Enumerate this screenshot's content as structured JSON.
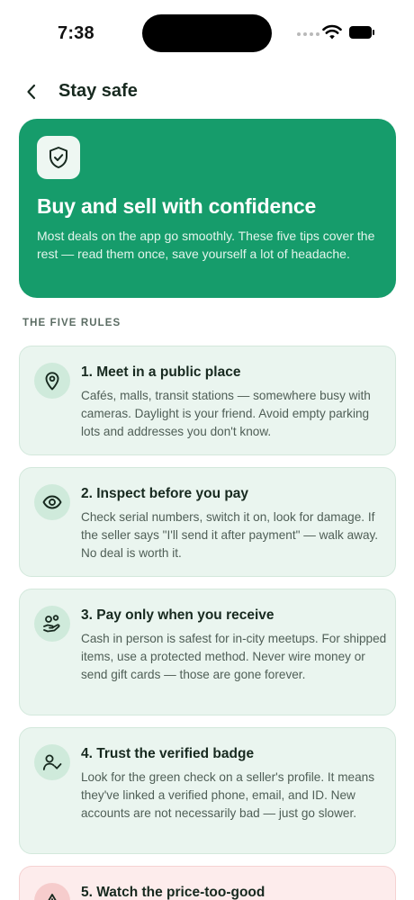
{
  "status": {
    "time": "7:38"
  },
  "nav": {
    "title": "Stay safe"
  },
  "hero": {
    "title": "Buy and sell with confidence",
    "body": "Most deals on the app go smoothly. These five tips cover the rest — read them once, save yourself a lot of headache."
  },
  "section_label": "THE FIVE RULES",
  "rules": [
    {
      "icon": "location-pin-icon",
      "title": "1. Meet in a public place",
      "body": "Cafés, malls, transit stations — somewhere busy with cameras. Daylight is your friend. Avoid empty parking lots and addresses you don't know."
    },
    {
      "icon": "eye-icon",
      "title": "2. Inspect before you pay",
      "body": "Check serial numbers, switch it on, look for damage. If the seller says \"I'll send it after payment\" — walk away. No deal is worth it."
    },
    {
      "icon": "hand-money-icon",
      "title": "3. Pay only when you receive",
      "body": "Cash in person is safest for in-city meetups. For shipped items, use a protected method. Never wire money or send gift cards — those are gone forever."
    },
    {
      "icon": "user-check-icon",
      "title": "4. Trust the verified badge",
      "body": "Look for the green check on a seller's profile. It means they've linked a verified phone, email, and ID. New accounts are not necessarily bad — just go slower."
    },
    {
      "icon": "warning-triangle-icon",
      "title": "5. Watch the price-too-good",
      "body": ""
    }
  ],
  "colors": {
    "accent": "#169c6b",
    "card_bg": "#eaf5ef",
    "warn_bg": "#fdecec"
  }
}
